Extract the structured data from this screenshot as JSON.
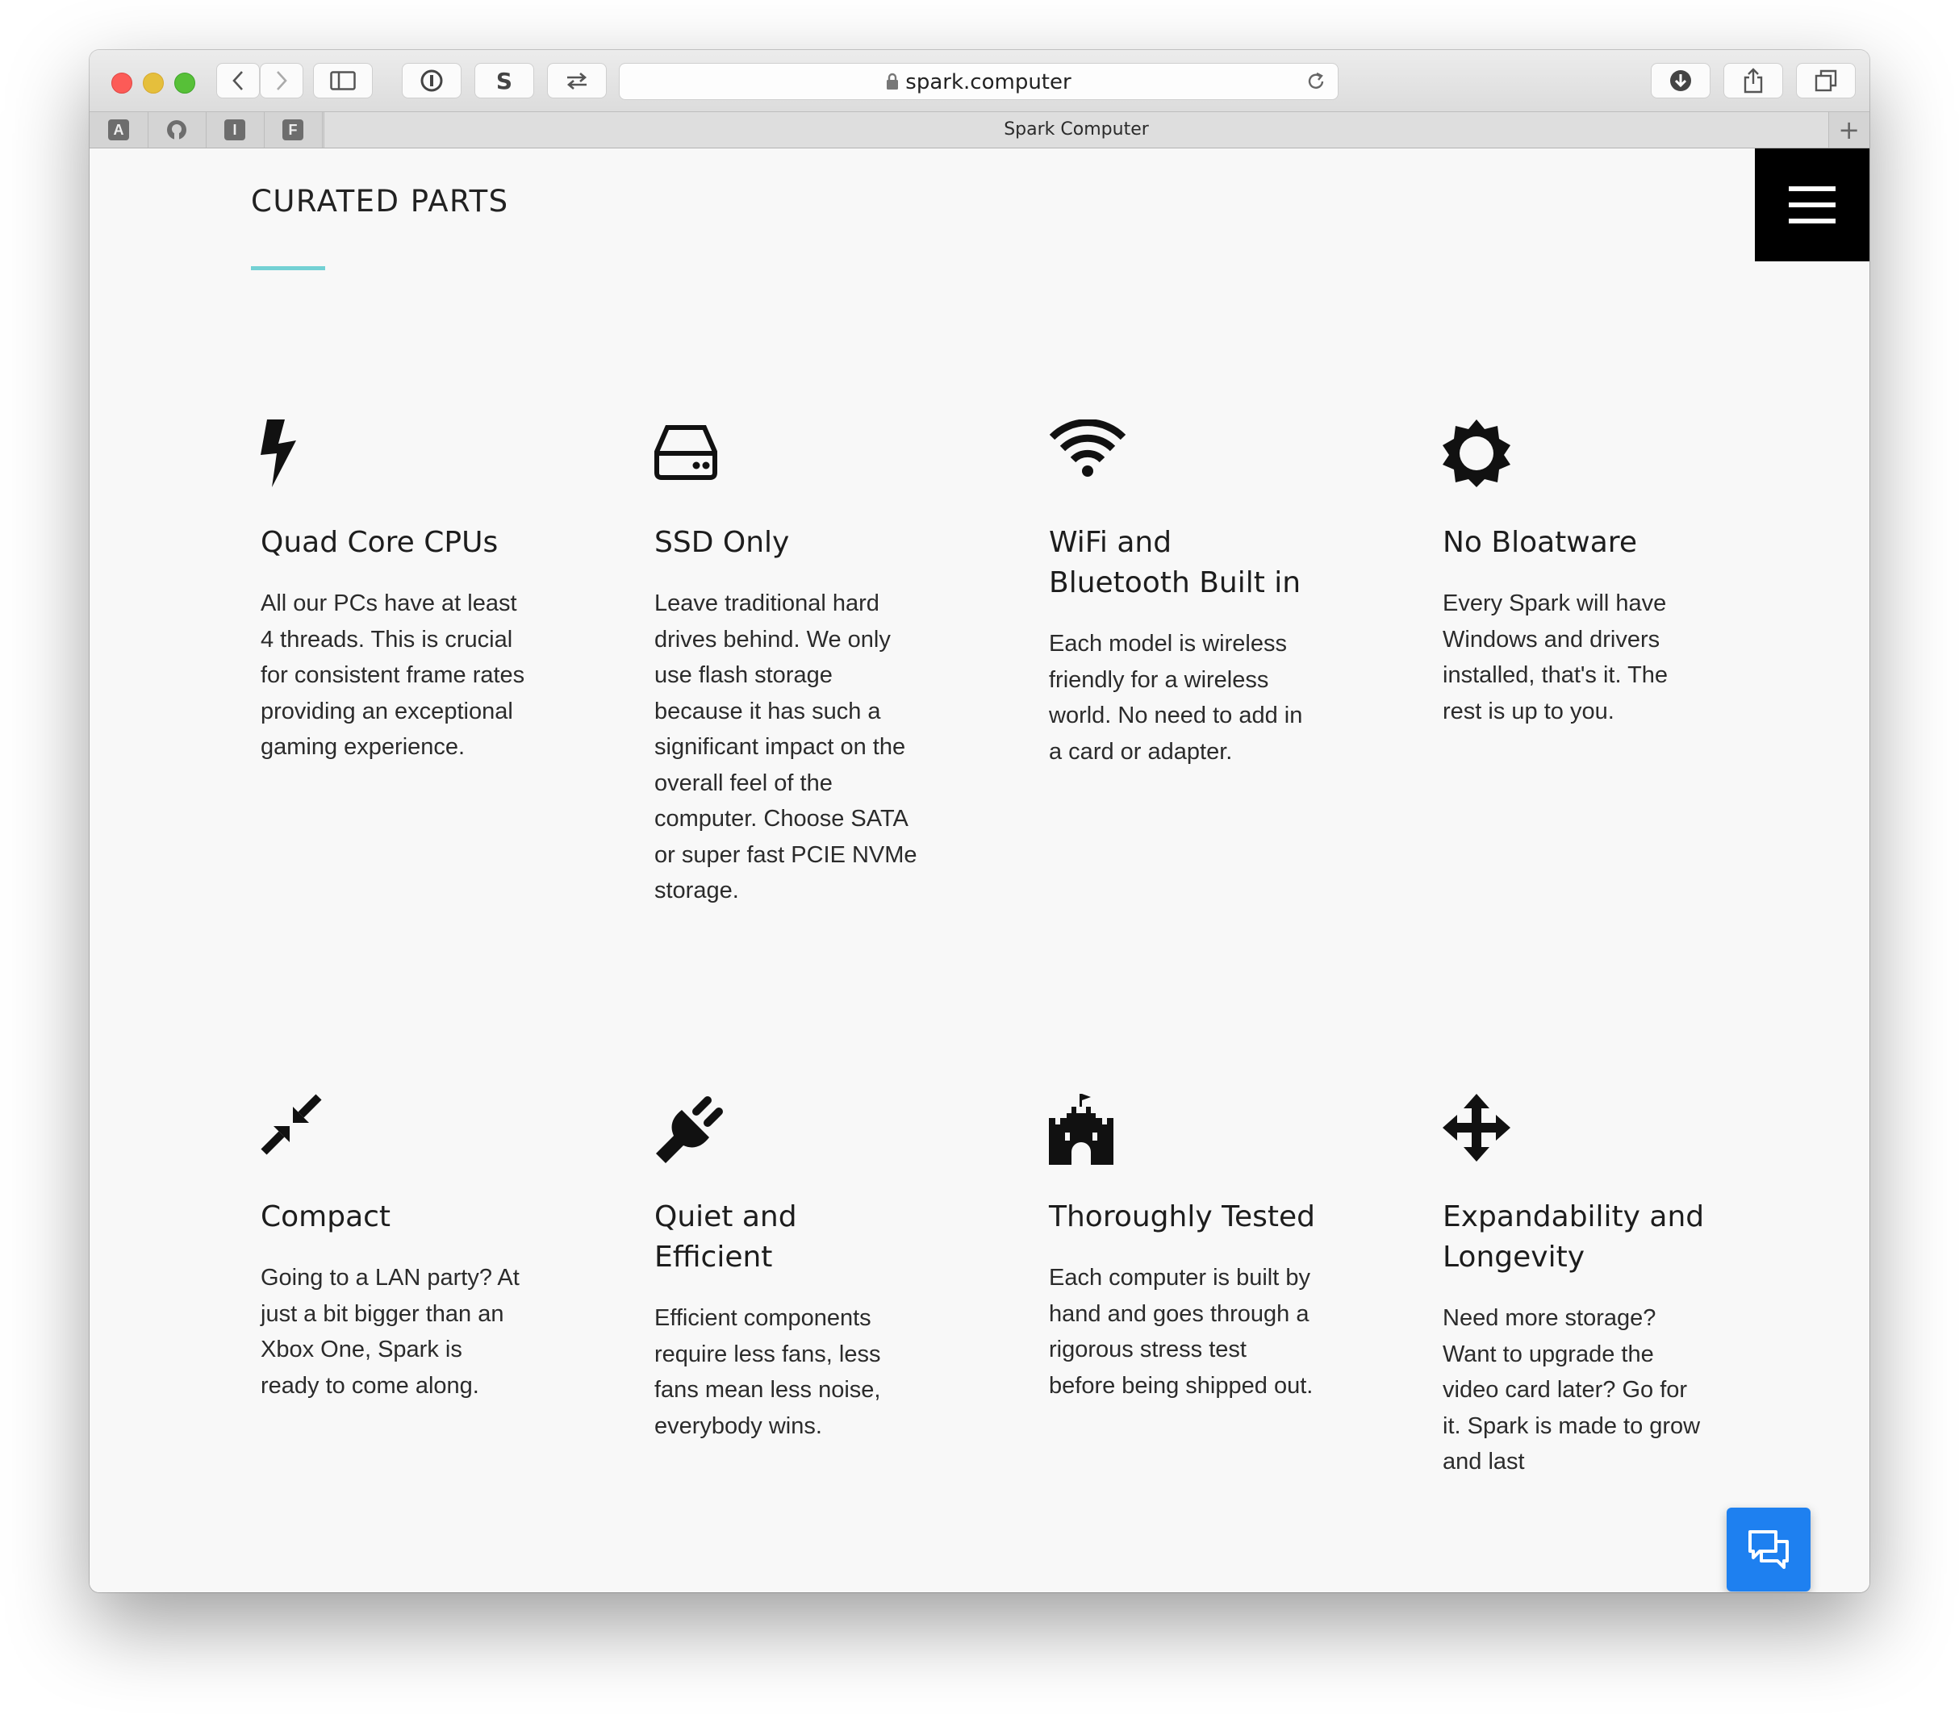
{
  "browser": {
    "url": "spark.computer",
    "tab_title": "Spark Computer",
    "new_tab_label": "+",
    "sync_button_label": "S",
    "pinned_tabs": [
      {
        "label": "A",
        "icon": "a-badge-icon"
      },
      {
        "label": "",
        "icon": "github-icon"
      },
      {
        "label": "I",
        "icon": "i-badge-icon"
      },
      {
        "label": "F",
        "icon": "f-badge-icon"
      }
    ]
  },
  "page": {
    "section_title": "CURATED PARTS",
    "accent_color": "#73d1d4",
    "features": [
      {
        "icon": "lightning-bolt-icon",
        "title": "Quad Core CPUs",
        "text": "All our PCs have at least 4 threads. This is crucial for consistent frame rates providing an exceptional gaming experience."
      },
      {
        "icon": "hard-drive-icon",
        "title": "SSD Only",
        "text": "Leave traditional hard drives behind. We only use flash storage because it has such a significant impact on the overall feel of the computer. Choose SATA or super fast PCIE NVMe storage."
      },
      {
        "icon": "wifi-icon",
        "title": "WiFi and Bluetooth Built in",
        "text": "Each model is wireless friendly for a wireless world. No need to add in a card or adapter."
      },
      {
        "icon": "sun-icon",
        "title": "No Bloatware",
        "text": "Every Spark will have Windows and drivers installed, that's it. The rest is up to you."
      },
      {
        "icon": "compress-arrows-icon",
        "title": "Compact",
        "text": "Going to a LAN party? At just a bit bigger than an Xbox One, Spark is ready to come along."
      },
      {
        "icon": "power-plug-icon",
        "title": "Quiet and Efficient",
        "text": "Efficient components require less fans, less fans mean less noise, everybody wins."
      },
      {
        "icon": "castle-icon",
        "title": "Thoroughly Tested",
        "text": "Each computer is built by hand and goes through a rigorous stress test before being shipped out."
      },
      {
        "icon": "move-arrows-icon",
        "title": "Expandability and Longevity",
        "text": "Need more storage? Want to upgrade the video card later? Go for it. Spark is made to grow and last"
      }
    ],
    "chat_button_color": "#1e80f0"
  }
}
